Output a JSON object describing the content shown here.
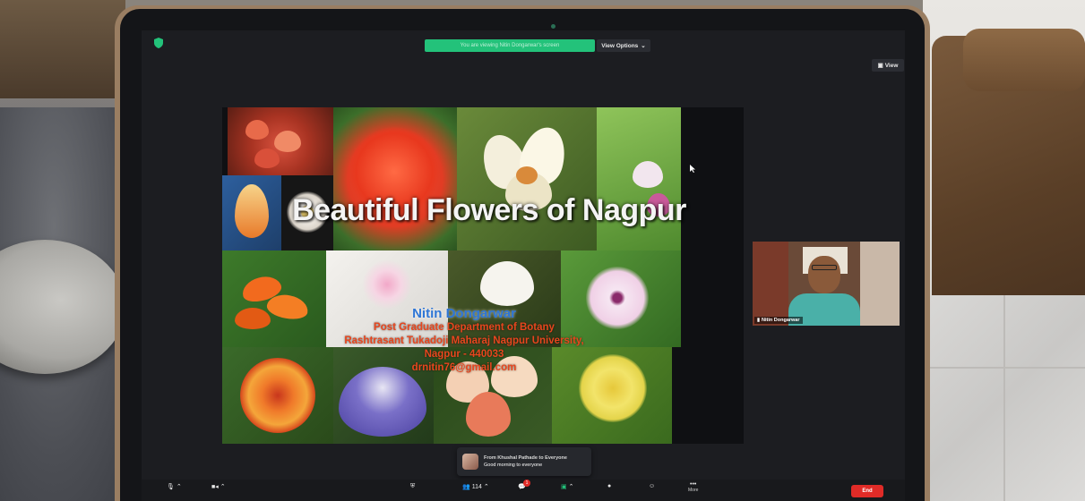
{
  "zoom": {
    "banner_text": "You are viewing Nitin Dongarwar's screen",
    "view_options_label": "View Options",
    "view_label": "View"
  },
  "slide": {
    "title": "Beautiful Flowers of Nagpur",
    "author": "Nitin Dongarwar",
    "department": "Post Graduate Department of Botany",
    "university": "Rashtrasant Tukadoji Maharaj Nagpur University,",
    "city": "Nagpur - 440033",
    "email": "drnitin76@gmail.com"
  },
  "participant": {
    "name": "Nitin Dongarwar"
  },
  "chat_toast": {
    "from": "From Khushal Pathade to Everyone",
    "message": "Good morning to everyone"
  },
  "toolbar": {
    "participants_count": "114",
    "chat_badge": "1",
    "end_label": "End",
    "more_label": "More",
    "reactions_label": "Reactions",
    "share_label": "Share Screen"
  },
  "colors": {
    "share_banner": "#23c27a",
    "end_button": "#e02b27",
    "author_blue": "#2f76d6",
    "subtitle_red": "#e8461e"
  }
}
